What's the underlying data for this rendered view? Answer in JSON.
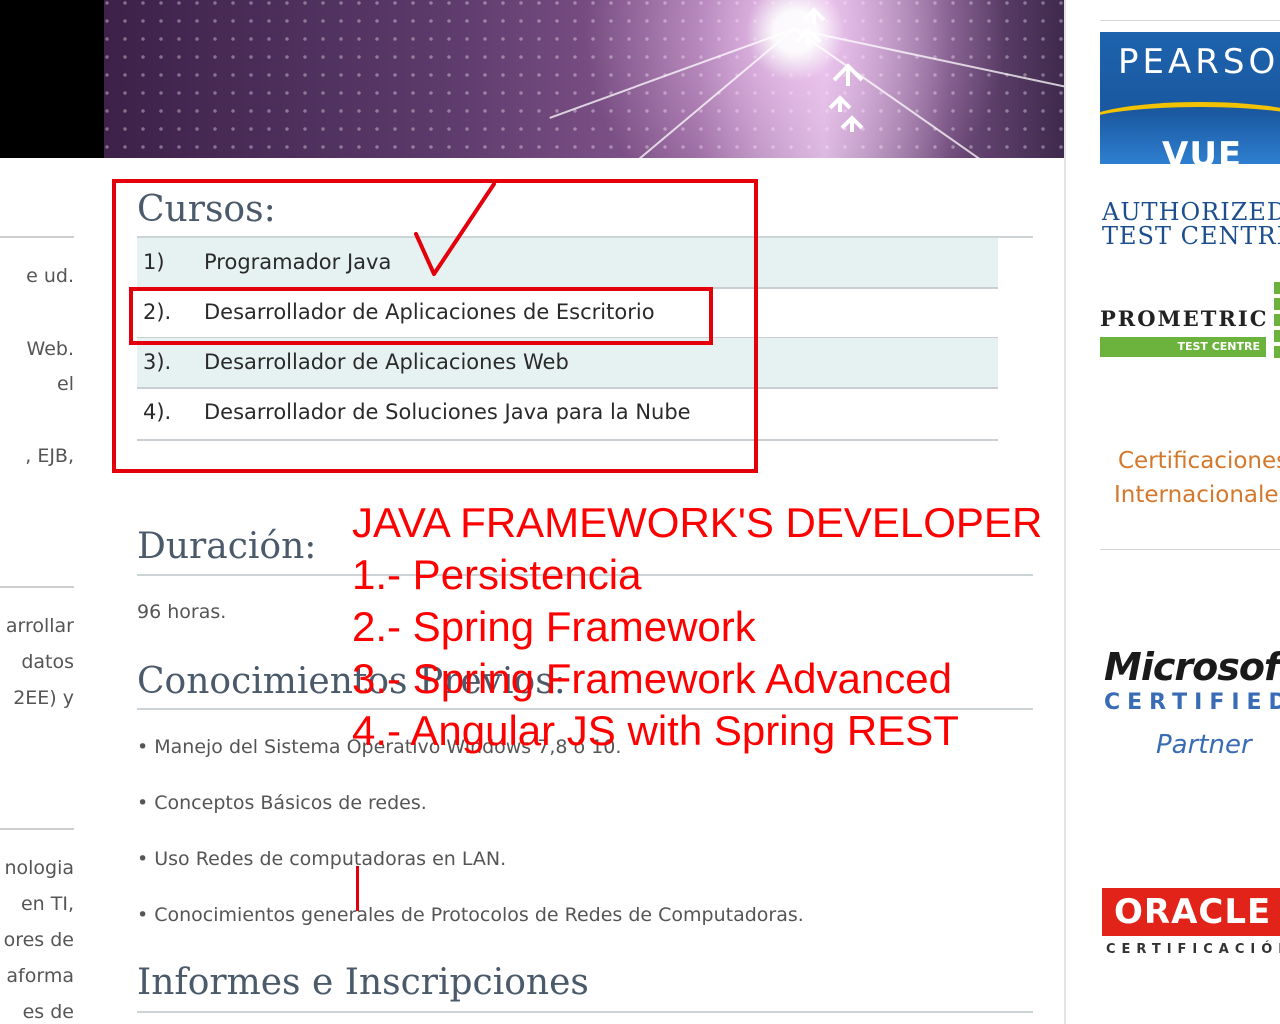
{
  "left_column": {
    "fragments": [
      "e ud.",
      "Web.",
      "el",
      ", EJB,",
      "arrollar",
      "datos",
      "2EE)   y",
      "nologia",
      "en    TI,",
      "ores de",
      "aforma",
      "es    de"
    ]
  },
  "sidebar": {
    "pearson": {
      "name": "PEARSON",
      "sub": "VUE"
    },
    "authorized": [
      "AUTHORIZED",
      "TEST CENTRE"
    ],
    "prometric": {
      "name": "PROMETRIC",
      "sub": "TEST CENTRE"
    },
    "certifications": [
      "Certificaciones",
      "Internacionales"
    ],
    "microsoft": {
      "name": "Microsoft",
      "sub": "CERTIFIED",
      "partner": "Partner"
    },
    "oracle": {
      "name": "ORACLE",
      "sub": "CERTIFICACIÓN"
    }
  },
  "main": {
    "cursos_title": "Cursos:",
    "courses": [
      {
        "num": "1)",
        "name": "Programador Java"
      },
      {
        "num": "2).",
        "name": "Desarrollador de Aplicaciones de Escritorio"
      },
      {
        "num": "3).",
        "name": "Desarrollador de Aplicaciones Web"
      },
      {
        "num": "4).",
        "name": "Desarrollador de Soluciones Java para la Nube"
      }
    ],
    "duracion_title": "Duración:",
    "duracion_value": "96 horas.",
    "conocimientos_title": "Conocimientos Previos:",
    "prerequisites": [
      "• Manejo del Sistema Operativo Windows 7,8 ó 10.",
      "• Conceptos Básicos de redes.",
      "• Uso Redes de computadoras en LAN.",
      "• Conocimientos generales de Protocolos de Redes de Computadoras."
    ],
    "informes_title": "Informes e Inscripciones"
  },
  "annotation": {
    "check_mark": "✓",
    "lines": [
      "JAVA FRAMEWORK'S DEVELOPER",
      "1.- Persistencia",
      "2.- Spring Framework",
      "3.- Spring Framework Advanced",
      "4.- Angular JS with Spring REST"
    ],
    "color": "#ff0000"
  }
}
